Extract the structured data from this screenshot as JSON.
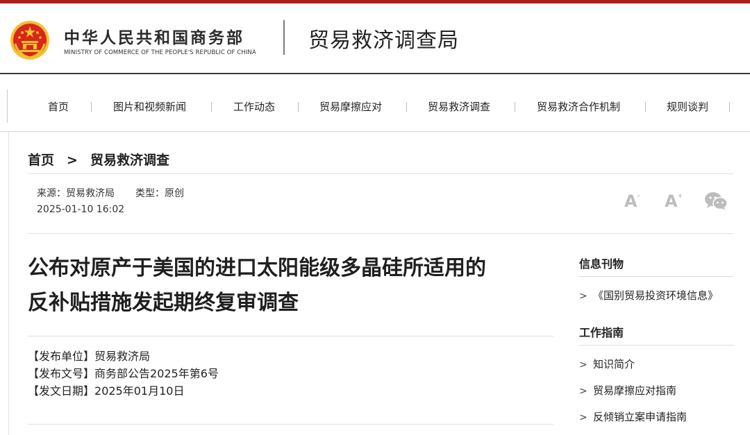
{
  "colors": {
    "brand_red": "#b01c1c",
    "emblem_red": "#d9261c",
    "emblem_gold": "#f2c230",
    "muted_icon": "#bdbdbd"
  },
  "header": {
    "ministry_cn": "中华人民共和国商务部",
    "ministry_en": "MINISTRY OF COMMERCE OF THE PEOPLE'S REPUBLIC OF CHINA",
    "bureau": "贸易救济调查局",
    "emblem_icon": "national-emblem-icon"
  },
  "nav": {
    "items": [
      {
        "label": "首页"
      },
      {
        "label": "图片和视频新闻"
      },
      {
        "label": "工作动态"
      },
      {
        "label": "贸易摩擦应对"
      },
      {
        "label": "贸易救济调查"
      },
      {
        "label": "贸易救济合作机制"
      },
      {
        "label": "规则谈判"
      }
    ]
  },
  "breadcrumb": {
    "home": "首页",
    "separator": ">",
    "current": "贸易救济调查"
  },
  "meta": {
    "source_label": "来源：",
    "source": "贸易救济局",
    "type_label": "类型：",
    "type": "原创",
    "datetime": "2025-01-10 16:02"
  },
  "tools": {
    "font_smaller": "A",
    "font_smaller_mark": "-",
    "font_larger": "A",
    "font_larger_mark": "+",
    "share_icon": "wechat-icon"
  },
  "article": {
    "title_line1": "公布对原产于美国的进口太阳能级多晶硅所适用的",
    "title_line2": "反补贴措施发起期终复审调查",
    "info": [
      {
        "label": "【发布单位】",
        "value": "贸易救济局"
      },
      {
        "label": "【发布文号】",
        "value": "商务部公告2025年第6号"
      },
      {
        "label": "【发文日期】",
        "value": "2025年01月10日"
      }
    ]
  },
  "sidebar": {
    "section1_title": "信息刊物",
    "section1_items": [
      {
        "label": "《国别贸易投资环境信息》"
      }
    ],
    "section2_title": "工作指南",
    "section2_items": [
      {
        "label": "知识简介"
      },
      {
        "label": "贸易摩擦应对指南"
      },
      {
        "label": "反倾销立案申请指南"
      }
    ],
    "chevron": ">"
  }
}
